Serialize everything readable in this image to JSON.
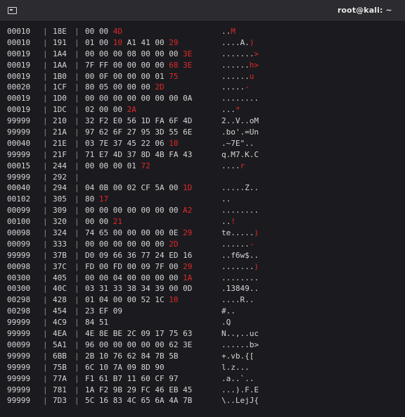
{
  "window": {
    "title": "root@kali: ~"
  },
  "separator": "|",
  "rows": [
    {
      "id": "00010",
      "off": "18E",
      "hex": [
        [
          "00",
          0
        ],
        [
          "00",
          0
        ],
        [
          "4D",
          1
        ]
      ],
      "ascii": [
        [
          "..",
          0
        ],
        [
          "M",
          1
        ]
      ]
    },
    {
      "id": "00010",
      "off": "191",
      "hex": [
        [
          "01",
          0
        ],
        [
          "00",
          0
        ],
        [
          "10",
          1
        ],
        [
          "A1",
          0
        ],
        [
          "41",
          0
        ],
        [
          "00",
          0
        ],
        [
          "29",
          1
        ]
      ],
      "ascii": [
        [
          "....A.",
          0
        ],
        [
          ")",
          1
        ]
      ]
    },
    {
      "id": "00019",
      "off": "1A4",
      "hex": [
        [
          "00",
          0
        ],
        [
          "00",
          0
        ],
        [
          "00",
          0
        ],
        [
          "08",
          0
        ],
        [
          "00",
          0
        ],
        [
          "00",
          0
        ],
        [
          "00",
          0
        ],
        [
          "3E",
          1
        ]
      ],
      "ascii": [
        [
          ".......",
          0
        ],
        [
          ">",
          1
        ]
      ]
    },
    {
      "id": "00019",
      "off": "1AA",
      "hex": [
        [
          "7F",
          0
        ],
        [
          "FF",
          0
        ],
        [
          "00",
          0
        ],
        [
          "00",
          0
        ],
        [
          "00",
          0
        ],
        [
          "00",
          0
        ],
        [
          "68",
          1
        ],
        [
          "3E",
          1
        ]
      ],
      "ascii": [
        [
          "......",
          0
        ],
        [
          "h>",
          1
        ]
      ]
    },
    {
      "id": "00019",
      "off": "1B0",
      "hex": [
        [
          "00",
          0
        ],
        [
          "0F",
          0
        ],
        [
          "00",
          0
        ],
        [
          "00",
          0
        ],
        [
          "00",
          0
        ],
        [
          "01",
          0
        ],
        [
          "75",
          1
        ]
      ],
      "ascii": [
        [
          "......",
          0
        ],
        [
          "u",
          1
        ]
      ]
    },
    {
      "id": "00020",
      "off": "1CF",
      "hex": [
        [
          "80",
          0
        ],
        [
          "05",
          0
        ],
        [
          "00",
          0
        ],
        [
          "00",
          0
        ],
        [
          "00",
          0
        ],
        [
          "2D",
          1
        ]
      ],
      "ascii": [
        [
          ".....",
          0
        ],
        [
          "-",
          1
        ]
      ]
    },
    {
      "id": "00019",
      "off": "1D0",
      "hex": [
        [
          "00",
          0
        ],
        [
          "00",
          0
        ],
        [
          "00",
          0
        ],
        [
          "00",
          0
        ],
        [
          "00",
          0
        ],
        [
          "00",
          0
        ],
        [
          "00",
          0
        ],
        [
          "0A",
          0
        ]
      ],
      "ascii": [
        [
          "........",
          0
        ]
      ]
    },
    {
      "id": "00019",
      "off": "1DC",
      "hex": [
        [
          "02",
          0
        ],
        [
          "00",
          0
        ],
        [
          "00",
          0
        ],
        [
          "2A",
          1
        ]
      ],
      "ascii": [
        [
          "...",
          0
        ],
        [
          "*",
          1
        ]
      ]
    },
    {
      "id": "99999",
      "off": "210",
      "hex": [
        [
          "32",
          0
        ],
        [
          "F2",
          0
        ],
        [
          "E0",
          0
        ],
        [
          "56",
          0
        ],
        [
          "1D",
          0
        ],
        [
          "FA",
          0
        ],
        [
          "6F",
          0
        ],
        [
          "4D",
          0
        ]
      ],
      "ascii": [
        [
          "2..V..oM",
          0
        ]
      ]
    },
    {
      "id": "99999",
      "off": "21A",
      "hex": [
        [
          "97",
          0
        ],
        [
          "62",
          0
        ],
        [
          "6F",
          0
        ],
        [
          "27",
          0
        ],
        [
          "95",
          0
        ],
        [
          "3D",
          0
        ],
        [
          "55",
          0
        ],
        [
          "6E",
          0
        ]
      ],
      "ascii": [
        [
          ".bo'.=Un",
          0
        ]
      ]
    },
    {
      "id": "00040",
      "off": "21E",
      "hex": [
        [
          "03",
          0
        ],
        [
          "7E",
          0
        ],
        [
          "37",
          0
        ],
        [
          "45",
          0
        ],
        [
          "22",
          0
        ],
        [
          "06",
          0
        ],
        [
          "10",
          1
        ]
      ],
      "ascii": [
        [
          ".~7E\"..",
          0
        ]
      ]
    },
    {
      "id": "99999",
      "off": "21F",
      "hex": [
        [
          "71",
          0
        ],
        [
          "E7",
          0
        ],
        [
          "4D",
          0
        ],
        [
          "37",
          0
        ],
        [
          "8D",
          0
        ],
        [
          "4B",
          0
        ],
        [
          "FA",
          0
        ],
        [
          "43",
          0
        ]
      ],
      "ascii": [
        [
          "q.M7.K.C",
          0
        ]
      ]
    },
    {
      "id": "00015",
      "off": "244",
      "hex": [
        [
          "00",
          0
        ],
        [
          "00",
          0
        ],
        [
          "00",
          0
        ],
        [
          "01",
          0
        ],
        [
          "72",
          1
        ]
      ],
      "ascii": [
        [
          "....",
          0
        ],
        [
          "r",
          1
        ]
      ]
    },
    {
      "id": "99999",
      "off": "292",
      "hex": [],
      "ascii": []
    },
    {
      "id": "00040",
      "off": "294",
      "hex": [
        [
          "04",
          0
        ],
        [
          "0B",
          0
        ],
        [
          "00",
          0
        ],
        [
          "02",
          0
        ],
        [
          "CF",
          0
        ],
        [
          "5A",
          0
        ],
        [
          "00",
          0
        ],
        [
          "1D",
          1
        ]
      ],
      "ascii": [
        [
          ".....Z..",
          0
        ]
      ]
    },
    {
      "id": "00102",
      "off": "305",
      "hex": [
        [
          "80",
          0
        ],
        [
          "17",
          1
        ]
      ],
      "ascii": [
        [
          "..",
          0
        ]
      ]
    },
    {
      "id": "00099",
      "off": "309",
      "hex": [
        [
          "00",
          0
        ],
        [
          "00",
          0
        ],
        [
          "00",
          0
        ],
        [
          "00",
          0
        ],
        [
          "00",
          0
        ],
        [
          "00",
          0
        ],
        [
          "00",
          0
        ],
        [
          "A2",
          1
        ]
      ],
      "ascii": [
        [
          "........",
          0
        ]
      ]
    },
    {
      "id": "00100",
      "off": "320",
      "hex": [
        [
          "00",
          0
        ],
        [
          "00",
          0
        ],
        [
          "21",
          1
        ]
      ],
      "ascii": [
        [
          "..",
          0
        ],
        [
          "!",
          1
        ]
      ]
    },
    {
      "id": "00098",
      "off": "324",
      "hex": [
        [
          "74",
          0
        ],
        [
          "65",
          0
        ],
        [
          "00",
          0
        ],
        [
          "00",
          0
        ],
        [
          "00",
          0
        ],
        [
          "00",
          0
        ],
        [
          "0E",
          0
        ],
        [
          "29",
          1
        ]
      ],
      "ascii": [
        [
          "te.....",
          0
        ],
        [
          ")",
          1
        ]
      ]
    },
    {
      "id": "00099",
      "off": "333",
      "hex": [
        [
          "00",
          0
        ],
        [
          "00",
          0
        ],
        [
          "00",
          0
        ],
        [
          "00",
          0
        ],
        [
          "00",
          0
        ],
        [
          "00",
          0
        ],
        [
          "2D",
          1
        ]
      ],
      "ascii": [
        [
          "......",
          0
        ],
        [
          "-",
          1
        ]
      ]
    },
    {
      "id": "99999",
      "off": "37B",
      "hex": [
        [
          "D0",
          0
        ],
        [
          "09",
          0
        ],
        [
          "66",
          0
        ],
        [
          "36",
          0
        ],
        [
          "77",
          0
        ],
        [
          "24",
          0
        ],
        [
          "ED",
          0
        ],
        [
          "16",
          0
        ]
      ],
      "ascii": [
        [
          "..f6w$..",
          0
        ]
      ]
    },
    {
      "id": "00098",
      "off": "37C",
      "hex": [
        [
          "FD",
          0
        ],
        [
          "00",
          0
        ],
        [
          "FD",
          0
        ],
        [
          "00",
          0
        ],
        [
          "09",
          0
        ],
        [
          "7F",
          0
        ],
        [
          "00",
          0
        ],
        [
          "29",
          1
        ]
      ],
      "ascii": [
        [
          ".......",
          0
        ],
        [
          ")",
          1
        ]
      ]
    },
    {
      "id": "00300",
      "off": "405",
      "hex": [
        [
          "00",
          0
        ],
        [
          "00",
          0
        ],
        [
          "04",
          0
        ],
        [
          "00",
          0
        ],
        [
          "00",
          0
        ],
        [
          "00",
          0
        ],
        [
          "00",
          0
        ],
        [
          "1A",
          1
        ]
      ],
      "ascii": [
        [
          "........",
          0
        ]
      ]
    },
    {
      "id": "00300",
      "off": "40C",
      "hex": [
        [
          "03",
          0
        ],
        [
          "31",
          0
        ],
        [
          "33",
          0
        ],
        [
          "38",
          0
        ],
        [
          "34",
          0
        ],
        [
          "39",
          0
        ],
        [
          "00",
          0
        ],
        [
          "0D",
          0
        ]
      ],
      "ascii": [
        [
          ".13849..",
          0
        ]
      ]
    },
    {
      "id": "00298",
      "off": "428",
      "hex": [
        [
          "01",
          0
        ],
        [
          "04",
          0
        ],
        [
          "00",
          0
        ],
        [
          "00",
          0
        ],
        [
          "52",
          0
        ],
        [
          "1C",
          0
        ],
        [
          "10",
          1
        ]
      ],
      "ascii": [
        [
          "....R..",
          0
        ]
      ]
    },
    {
      "id": "00298",
      "off": "454",
      "hex": [
        [
          "23",
          0
        ],
        [
          "EF",
          0
        ],
        [
          "09",
          0
        ]
      ],
      "ascii": [
        [
          "#..",
          0
        ]
      ]
    },
    {
      "id": "99999",
      "off": "4C9",
      "hex": [
        [
          "84",
          0
        ],
        [
          "51",
          0
        ]
      ],
      "ascii": [
        [
          ".Q",
          0
        ]
      ]
    },
    {
      "id": "99999",
      "off": "4EA",
      "hex": [
        [
          "4E",
          0
        ],
        [
          "8E",
          0
        ],
        [
          "BE",
          0
        ],
        [
          "2C",
          0
        ],
        [
          "09",
          0
        ],
        [
          "17",
          0
        ],
        [
          "75",
          0
        ],
        [
          "63",
          0
        ]
      ],
      "ascii": [
        [
          "N..,..uc",
          0
        ]
      ]
    },
    {
      "id": "00099",
      "off": "5A1",
      "hex": [
        [
          "96",
          0
        ],
        [
          "00",
          0
        ],
        [
          "00",
          0
        ],
        [
          "00",
          0
        ],
        [
          "00",
          0
        ],
        [
          "00",
          0
        ],
        [
          "62",
          0
        ],
        [
          "3E",
          0
        ]
      ],
      "ascii": [
        [
          "......b>",
          0
        ]
      ]
    },
    {
      "id": "99999",
      "off": "6BB",
      "hex": [
        [
          "2B",
          0
        ],
        [
          "10",
          0
        ],
        [
          "76",
          0
        ],
        [
          "62",
          0
        ],
        [
          "84",
          0
        ],
        [
          "7B",
          0
        ],
        [
          "5B",
          0
        ]
      ],
      "ascii": [
        [
          "+.vb.{[",
          0
        ]
      ]
    },
    {
      "id": "99999",
      "off": "75B",
      "hex": [
        [
          "6C",
          0
        ],
        [
          "10",
          0
        ],
        [
          "7A",
          0
        ],
        [
          "09",
          0
        ],
        [
          "8D",
          0
        ],
        [
          "90",
          0
        ]
      ],
      "ascii": [
        [
          "l.z...",
          0
        ]
      ]
    },
    {
      "id": "99999",
      "off": "77A",
      "hex": [
        [
          "F1",
          0
        ],
        [
          "61",
          0
        ],
        [
          "B7",
          0
        ],
        [
          "11",
          0
        ],
        [
          "60",
          0
        ],
        [
          "CF",
          0
        ],
        [
          "97",
          0
        ]
      ],
      "ascii": [
        [
          ".a..`..",
          0
        ]
      ]
    },
    {
      "id": "99999",
      "off": "781",
      "hex": [
        [
          "1A",
          0
        ],
        [
          "F2",
          0
        ],
        [
          "9B",
          0
        ],
        [
          "29",
          0
        ],
        [
          "FC",
          0
        ],
        [
          "46",
          0
        ],
        [
          "EB",
          0
        ],
        [
          "45",
          0
        ]
      ],
      "ascii": [
        [
          "...).F.E",
          0
        ]
      ]
    },
    {
      "id": "99999",
      "off": "7D3",
      "hex": [
        [
          "5C",
          0
        ],
        [
          "16",
          0
        ],
        [
          "83",
          0
        ],
        [
          "4C",
          0
        ],
        [
          "65",
          0
        ],
        [
          "6A",
          0
        ],
        [
          "4A",
          0
        ],
        [
          "7B",
          0
        ]
      ],
      "ascii": [
        [
          "\\..LejJ{",
          0
        ]
      ]
    }
  ]
}
